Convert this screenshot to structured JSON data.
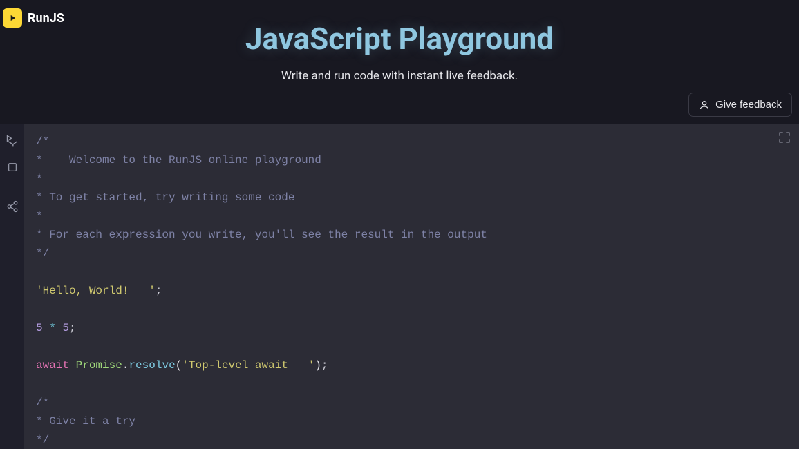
{
  "brand": {
    "name": "RunJS"
  },
  "hero": {
    "title": "JavaScript Playground",
    "subtitle": "Write and run code with instant live feedback."
  },
  "feedback": {
    "label": "Give feedback"
  },
  "toolbar": {
    "run": "run-icon",
    "stop": "stop-icon",
    "share": "share-icon"
  },
  "code": {
    "c1": "/*",
    "c2": "*    Welcome to the RunJS online playground",
    "c3": "*",
    "c4": "* To get started, try writing some code",
    "c5": "*",
    "c6": "* For each expression you write, you'll see the result in the output panel",
    "c7": "*/",
    "hello": "'Hello, World!   '",
    "semi": ";",
    "n5a": "5",
    "op_star": " * ",
    "n5b": "5",
    "await": "await",
    "sp": " ",
    "promise": "Promise",
    "dot": ".",
    "resolve": "resolve",
    "lp": "(",
    "topstr": "'Top-level await   '",
    "rp": ")",
    "c8": "/*",
    "c9": "* Give it a try",
    "c10": "*/"
  }
}
